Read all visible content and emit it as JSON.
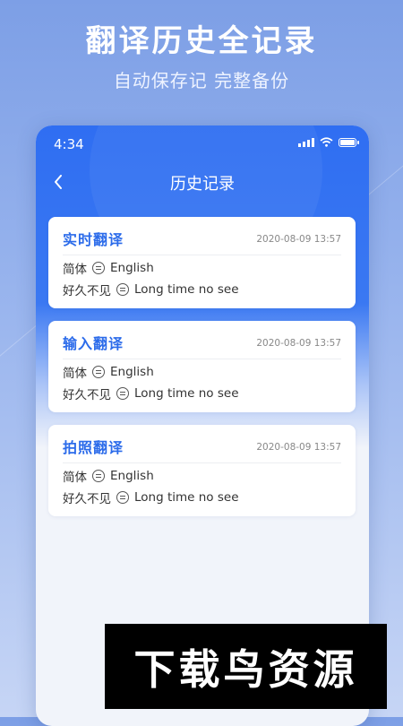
{
  "promo": {
    "title": "翻译历史全记录",
    "subtitle": "自动保存记 完整备份"
  },
  "status_bar": {
    "time": "4:34",
    "icons": [
      "signal-icon",
      "wifi-icon",
      "battery-icon"
    ]
  },
  "nav": {
    "back_icon": "chevron-left-icon",
    "title": "历史记录"
  },
  "history": [
    {
      "title": "实时翻译",
      "date": "2020-08-09 13:57",
      "lang_from": "简体",
      "lang_to": "English",
      "source_text": "好久不见",
      "target_text": "Long time no see"
    },
    {
      "title": "输入翻译",
      "date": "2020-08-09 13:57",
      "lang_from": "简体",
      "lang_to": "English",
      "source_text": "好久不见",
      "target_text": "Long time no see"
    },
    {
      "title": "拍照翻译",
      "date": "2020-08-09 13:57",
      "lang_from": "简体",
      "lang_to": "English",
      "source_text": "好久不见",
      "target_text": "Long time no see"
    }
  ],
  "watermark": {
    "text": "下载鸟资源"
  },
  "colors": {
    "accent": "#2b6bea",
    "header_blue": "#2f6ef2"
  }
}
